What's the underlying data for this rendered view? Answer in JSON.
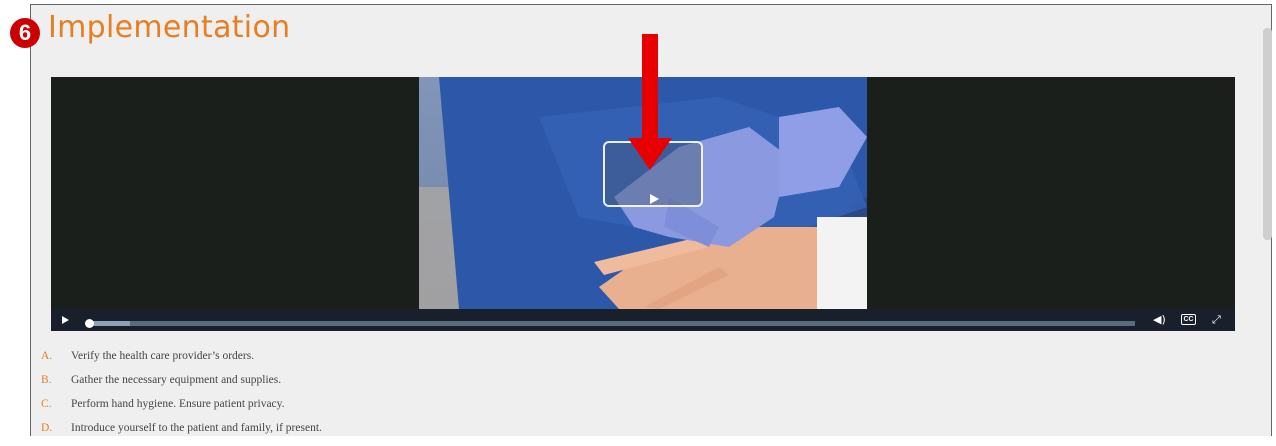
{
  "section": {
    "step_number": "6",
    "title": "Implementation"
  },
  "video": {
    "big_play_icon": "play-icon",
    "controls": {
      "play_icon": "play-icon",
      "volume_icon": "volume-icon",
      "captions_label": "CC",
      "fullscreen_icon": "fullscreen-icon",
      "progress_fraction": 0.0
    }
  },
  "steps": [
    {
      "letter": "A.",
      "text": "Verify the health care provider’s orders."
    },
    {
      "letter": "B.",
      "text": "Gather the necessary equipment and supplies."
    },
    {
      "letter": "C.",
      "text": "Perform hand hygiene. Ensure patient privacy."
    },
    {
      "letter": "D.",
      "text": "Introduce yourself to the patient and family, if present."
    }
  ],
  "colors": {
    "accent": "#e67e22",
    "annotation_arrow": "#e60000",
    "badge": "#cc0000"
  }
}
